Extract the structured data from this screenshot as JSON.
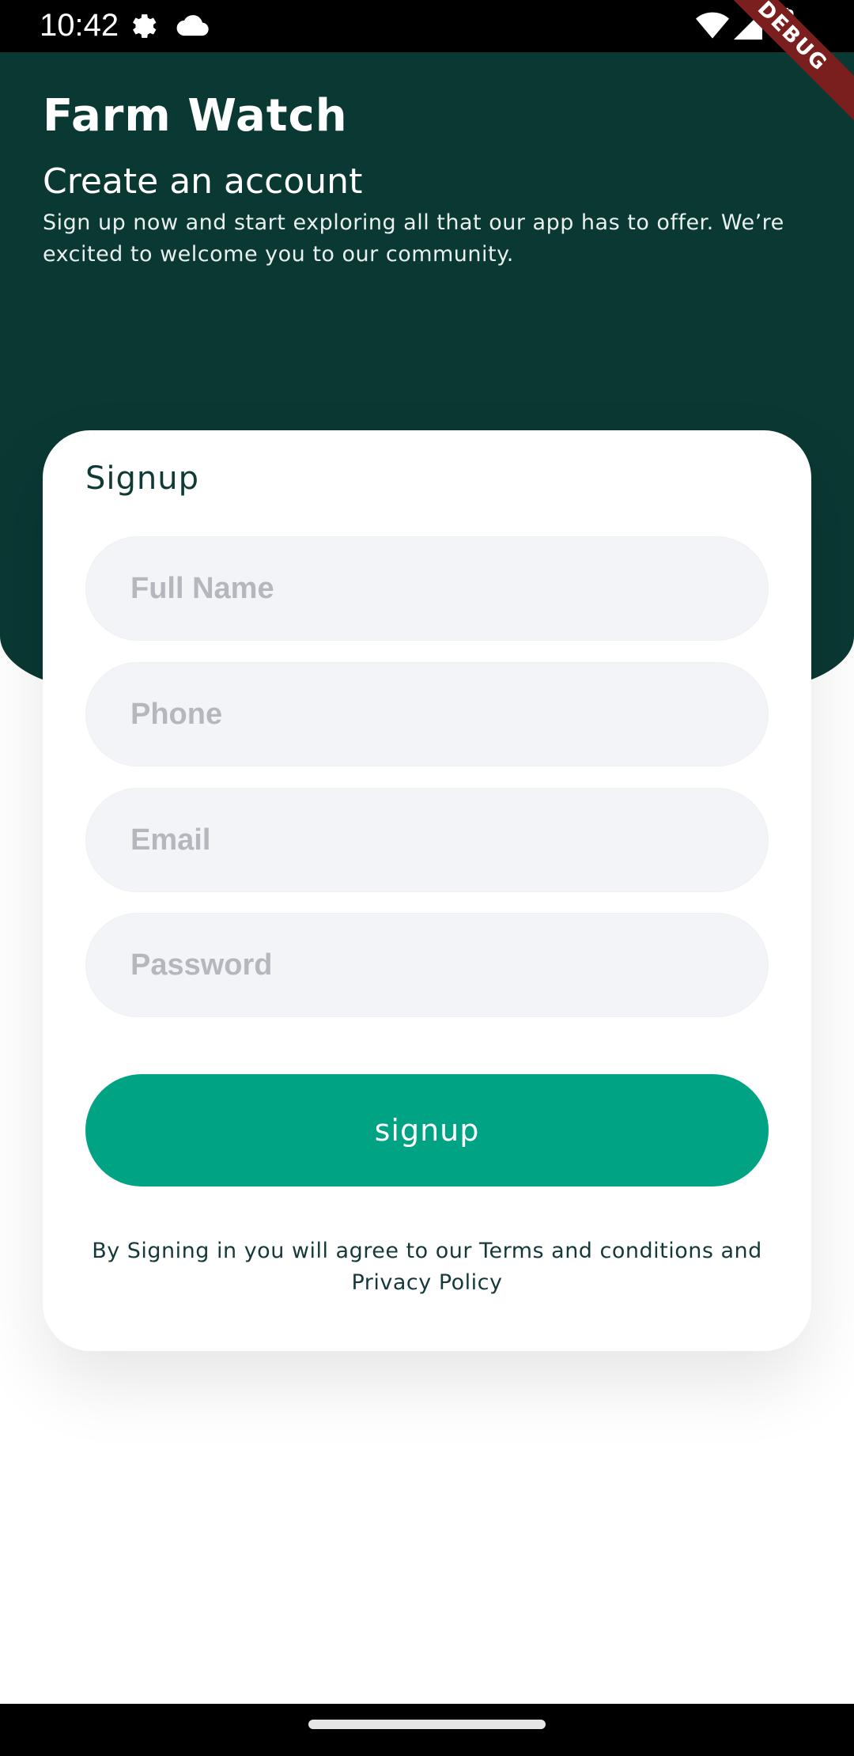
{
  "status_bar": {
    "time": "10:42",
    "icons": [
      "settings-gear-icon",
      "cloud-icon",
      "wifi-icon",
      "cellular-signal-icon",
      "battery-icon"
    ]
  },
  "debug_banner": "DEBUG",
  "header": {
    "app_title": "Farm Watch",
    "subtitle": "Create an account",
    "description": "Sign up now and start exploring all that our app has to offer. We’re excited to welcome you to our community."
  },
  "card": {
    "title": "Signup",
    "fields": {
      "full_name": {
        "placeholder": "Full Name",
        "value": ""
      },
      "phone": {
        "placeholder": "Phone",
        "value": ""
      },
      "email": {
        "placeholder": "Email",
        "value": ""
      },
      "password": {
        "placeholder": "Password",
        "value": ""
      }
    },
    "signup_label": "signup",
    "terms_text": "By Signing in you will agree to our Terms and conditions and Privacy Policy"
  },
  "colors": {
    "header_bg": "#0a3833",
    "button_bg": "#00a383",
    "field_bg": "#f3f4f7",
    "debug_bg": "#7a1e1e"
  }
}
